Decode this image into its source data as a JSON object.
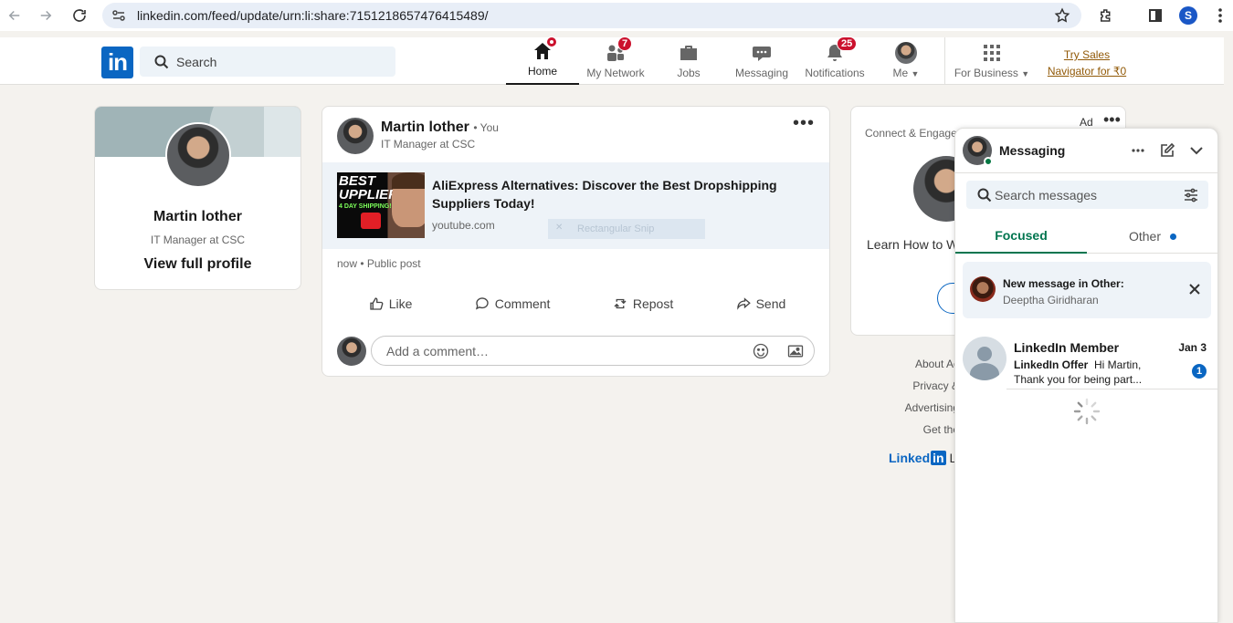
{
  "browser": {
    "url": "linkedin.com/feed/update/urn:li:share:7151218657476415489/",
    "profile_initial": "S"
  },
  "header": {
    "logo_text": "in",
    "search_placeholder": "Search",
    "nav": [
      {
        "label": "Home",
        "icon": "home-icon",
        "badge": "",
        "active": true
      },
      {
        "label": "My Network",
        "icon": "network-icon",
        "badge": "7"
      },
      {
        "label": "Jobs",
        "icon": "briefcase-icon",
        "badge": ""
      },
      {
        "label": "Messaging",
        "icon": "chat-icon",
        "badge": ""
      },
      {
        "label": "Notifications",
        "icon": "bell-icon",
        "badge": "25"
      },
      {
        "label": "Me",
        "icon": "avatar",
        "badge": ""
      },
      {
        "label": "For Business",
        "icon": "grid-icon",
        "badge": ""
      }
    ],
    "try_sales_line1": "Try Sales",
    "try_sales_line2": "Navigator for ₹0"
  },
  "profile": {
    "name": "Martin lother",
    "title": "IT Manager at CSC",
    "link": "View full profile"
  },
  "post": {
    "author": "Martin lother",
    "you": "• You",
    "subtitle": "IT Manager at CSC",
    "link_title": "AliExpress Alternatives: Discover the Best Dropshipping Suppliers Today!",
    "link_domain": "youtube.com",
    "thumb_line1": "BEST",
    "thumb_line2": "UPPLIERS",
    "thumb_line3": "4 DAY SHIPPING!",
    "snip_overlay": "Rectangular Snip",
    "meta": "now • Public post",
    "actions": {
      "like": "Like",
      "comment": "Comment",
      "repost": "Repost",
      "send": "Send"
    },
    "comment_placeholder": "Add a comment…"
  },
  "ad": {
    "label": "Ad",
    "connect": "Connect & Engage",
    "learn": "Learn How to W"
  },
  "footer": {
    "links": [
      "About  Ac",
      "Privacy &",
      "Advertising",
      "Get the"
    ],
    "brand": "Linked",
    "brand_in": "in",
    "brand_tail": "Li"
  },
  "messaging": {
    "title": "Messaging",
    "search_placeholder": "Search messages",
    "tabs": {
      "focused": "Focused",
      "other": "Other"
    },
    "notice": {
      "title": "New message in Other:",
      "sub": "Deeptha Giridharan"
    },
    "conversation": {
      "name": "LinkedIn Member",
      "date": "Jan 3",
      "sender": "LinkedIn Offer",
      "preview": "Hi Martin, Thank you for being part...",
      "unread": "1"
    }
  },
  "colors": {
    "brand": "#0a66c2",
    "accent_green": "#01754f",
    "badge_red": "#cb112d"
  }
}
